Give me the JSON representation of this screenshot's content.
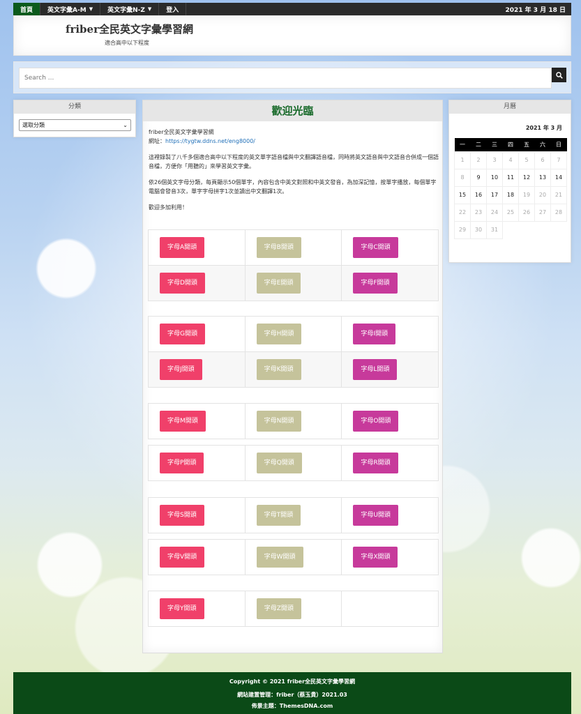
{
  "nav": {
    "items": [
      {
        "label": "首頁",
        "active": true,
        "dropdown": false
      },
      {
        "label": "英文字彙A-M",
        "active": false,
        "dropdown": true
      },
      {
        "label": "英文字彙N-Z",
        "active": false,
        "dropdown": true
      },
      {
        "label": "登入",
        "active": false,
        "dropdown": false
      }
    ],
    "date": "2021 年 3 月 18 日"
  },
  "header": {
    "title": "friber全民英文字彙學習網",
    "tagline": "適合高中以下程度"
  },
  "search": {
    "placeholder": "Search ...",
    "icon": "search-icon"
  },
  "sidebar_left": {
    "title": "分類",
    "select_value": "選取分類"
  },
  "calendar": {
    "title": "月曆",
    "month_label": "2021 年 3 月",
    "weekdays": [
      "一",
      "二",
      "三",
      "四",
      "五",
      "六",
      "日"
    ],
    "weeks": [
      [
        "1",
        "2",
        "3",
        "4",
        "5",
        "6",
        "7"
      ],
      [
        "8",
        "9",
        "10",
        "11",
        "12",
        "13",
        "14"
      ],
      [
        "15",
        "16",
        "17",
        "18",
        "19",
        "20",
        "21"
      ],
      [
        "22",
        "23",
        "24",
        "25",
        "26",
        "27",
        "28"
      ],
      [
        "29",
        "30",
        "31",
        "",
        "",
        "",
        ""
      ]
    ],
    "highlighted_days": [
      "9",
      "10",
      "11",
      "12",
      "13",
      "14",
      "15",
      "16",
      "17",
      "18"
    ]
  },
  "main": {
    "title": "歡迎光臨",
    "intro_line1": "friber全民英文字彙學習網",
    "intro_url_label": "網址：",
    "intro_url": "https://tygtw.ddns.net/eng8000/",
    "paragraph1": "這裡錄製了八千多個適合高中以下程度的英文單字語音檔與中文翻譯語音檔，同時將英文語音與中文語音合併成一個語音檔，方便你「用聽的」來學習英文字彙。",
    "paragraph2": "依26個英文字母分類，每頁顯示50個單字，內容包含中英文對照和中英文發音，為加深記憶，按單字播放，每個單字電腦會發音3次，單字字母拼字1次並讀出中文翻譯1次。",
    "paragraph3": "歡迎多加利用！",
    "button_colors": {
      "red": "#f0406a",
      "olive": "#c5c39b",
      "magenta": "#c73a9b"
    },
    "letter_buttons": [
      "字母A開頭",
      "字母B開頭",
      "字母C開頭",
      "字母D開頭",
      "字母E開頭",
      "字母F開頭",
      "字母G開頭",
      "字母H開頭",
      "字母I開頭",
      "字母J開頭",
      "字母K開頭",
      "字母L開頭",
      "字母M開頭",
      "字母N開頭",
      "字母O開頭",
      "字母P開頭",
      "字母Q開頭",
      "字母R開頭",
      "字母S開頭",
      "字母T開頭",
      "字母U開頭",
      "字母V開頭",
      "字母W開頭",
      "字母X開頭",
      "字母Y開頭",
      "字母Z開頭"
    ]
  },
  "footer": {
    "copyright": "Copyright © 2021 friber全民英文字彙學習網",
    "admin": "網站建置管理：friber（蔡玉貴）2021.03",
    "theme": "佈景主題：ThemesDNA.com"
  }
}
